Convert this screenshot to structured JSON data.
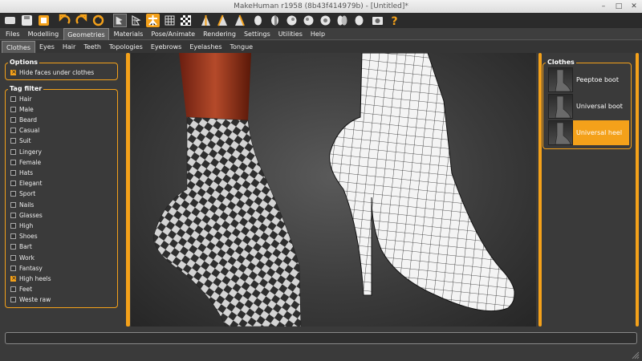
{
  "window": {
    "title": "MakeHuman r1958 (8b43f414979b) - [Untitled]*",
    "controls": [
      "minimize-icon",
      "maximize-icon",
      "close-icon"
    ]
  },
  "toolbar": {
    "icons": [
      "undo-arrow-icon",
      "redo-arrow-icon",
      "reset-icon",
      "smooth-icon",
      "wireframe-icon",
      "pose-icon",
      "grid-icon",
      "checker-icon",
      "front-view-icon",
      "side-view-icon",
      "back-view-icon",
      "top-view-icon",
      "left-view-icon",
      "right-view-icon",
      "bottom-view-icon",
      "camera-icon",
      "help-icon"
    ]
  },
  "menu": {
    "items": [
      "Files",
      "Modelling",
      "Geometries",
      "Materials",
      "Pose/Animate",
      "Rendering",
      "Settings",
      "Utilities",
      "Help"
    ],
    "active": "Geometries"
  },
  "subtabs": {
    "items": [
      "Clothes",
      "Eyes",
      "Hair",
      "Teeth",
      "Topologies",
      "Eyebrows",
      "Eyelashes",
      "Tongue"
    ],
    "active": "Clothes"
  },
  "options": {
    "title": "Options",
    "hide_faces_label": "Hide faces under clothes",
    "hide_faces_checked": true
  },
  "tag_filter": {
    "title": "Tag filter",
    "tags": [
      {
        "label": "Hair",
        "checked": false
      },
      {
        "label": "Male",
        "checked": false
      },
      {
        "label": "Beard",
        "checked": false
      },
      {
        "label": "Casual",
        "checked": false
      },
      {
        "label": "Suit",
        "checked": false
      },
      {
        "label": "Lingery",
        "checked": false
      },
      {
        "label": "Female",
        "checked": false
      },
      {
        "label": "Hats",
        "checked": false
      },
      {
        "label": "Elegant",
        "checked": false
      },
      {
        "label": "Sport",
        "checked": false
      },
      {
        "label": "Nails",
        "checked": false
      },
      {
        "label": "Glasses",
        "checked": false
      },
      {
        "label": "High",
        "checked": false
      },
      {
        "label": "Shoes",
        "checked": false
      },
      {
        "label": "Bart",
        "checked": false
      },
      {
        "label": "Work",
        "checked": false
      },
      {
        "label": "Fantasy",
        "checked": false
      },
      {
        "label": "High heels",
        "checked": true
      },
      {
        "label": "Feet",
        "checked": false
      },
      {
        "label": "Weste raw",
        "checked": false
      }
    ]
  },
  "clothes_panel": {
    "title": "Clothes",
    "items": [
      {
        "label": "Peeptoe boot",
        "selected": false
      },
      {
        "label": "Universal boot",
        "selected": false
      },
      {
        "label": "Universal heel",
        "selected": true
      }
    ]
  },
  "colors": {
    "accent": "#f4a11a",
    "background": "#3a3a3a",
    "toolbar": "#2b2b2b"
  }
}
